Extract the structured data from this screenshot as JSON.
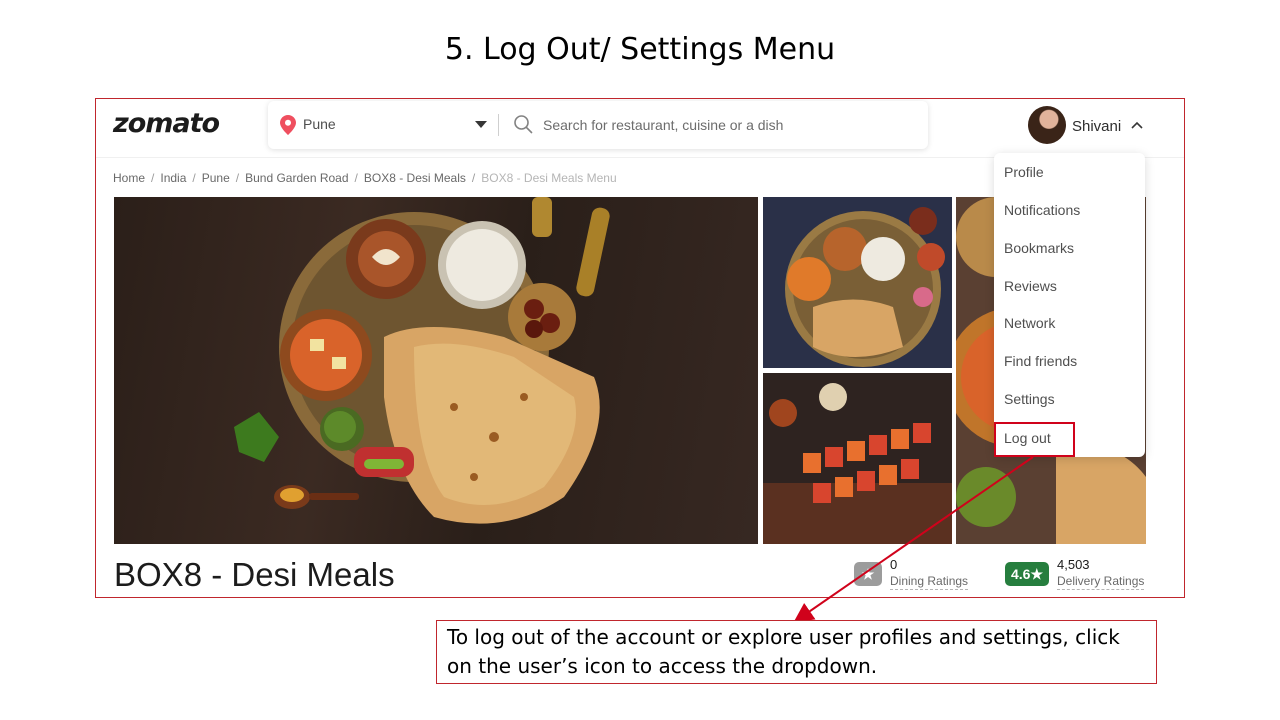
{
  "slide": {
    "title": "5. Log Out/ Settings Menu",
    "callout": "To log out of the account or explore user profiles and settings, click on the user’s icon to access the dropdown."
  },
  "header": {
    "logo": "zomato",
    "location": "Pune",
    "search_placeholder": "Search for restaurant, cuisine or a dish",
    "user_name": "Shivani"
  },
  "breadcrumb": [
    "Home",
    "India",
    "Pune",
    "Bund Garden Road",
    "BOX8 - Desi Meals",
    "BOX8 - Desi Meals Menu"
  ],
  "dropdown": {
    "items": [
      "Profile",
      "Notifications",
      "Bookmarks",
      "Reviews",
      "Network",
      "Find friends",
      "Settings",
      "Log out"
    ]
  },
  "restaurant": {
    "name": "BOX8 - Desi Meals",
    "dining": {
      "count": "0",
      "label": "Dining Ratings",
      "badge": "★"
    },
    "delivery": {
      "rating": "4.6★",
      "count": "4,503",
      "label": "Delivery Ratings"
    }
  },
  "colors": {
    "annotation_red": "#d0021b",
    "frame_red": "#c0262d",
    "zomato_red": "#ef4f5f",
    "rating_green": "#267e3e"
  }
}
